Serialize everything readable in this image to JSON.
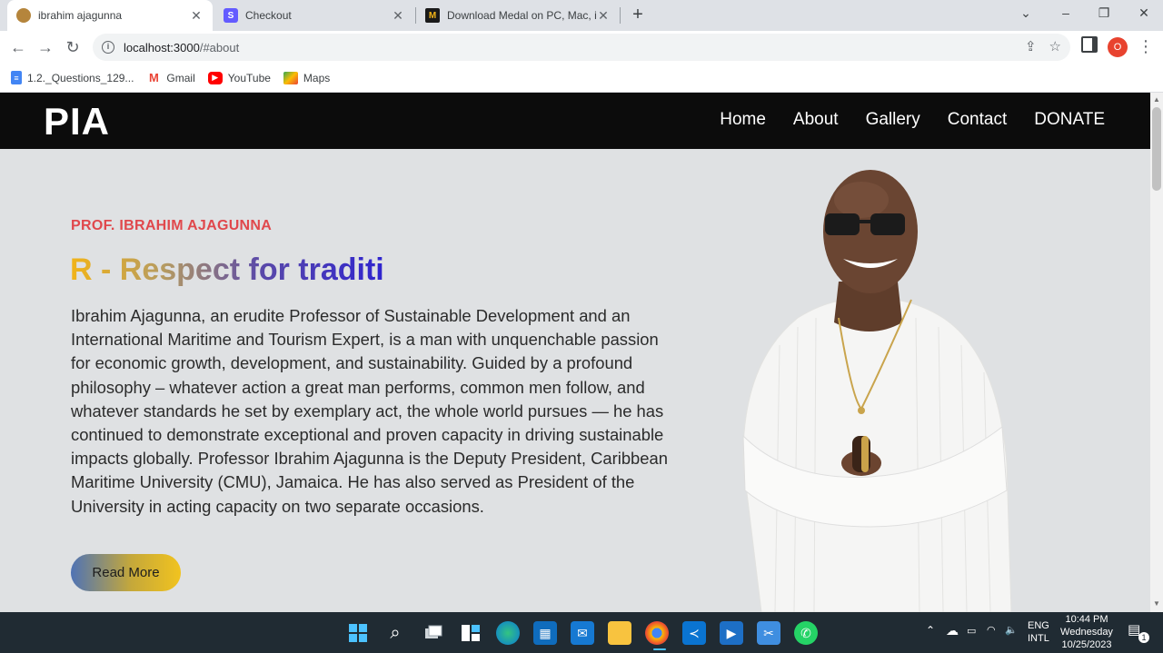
{
  "browser": {
    "tabs": [
      {
        "title": "ibrahim ajagunna",
        "active": true
      },
      {
        "title": "Checkout",
        "active": false
      },
      {
        "title": "Download Medal on PC, Mac, iO",
        "active": false
      }
    ],
    "url_host": "localhost:3000",
    "url_path": "/#about",
    "profile_initial": "O",
    "bookmarks": [
      {
        "label": "1.2._Questions_129...",
        "icon": "docs-icon"
      },
      {
        "label": "Gmail",
        "icon": "gmail-icon"
      },
      {
        "label": "YouTube",
        "icon": "youtube-icon"
      },
      {
        "label": "Maps",
        "icon": "maps-icon"
      }
    ]
  },
  "site": {
    "logo": "PIA",
    "menu": [
      "Home",
      "About",
      "Gallery",
      "Contact",
      "DONATE"
    ],
    "eyebrow": "PROF. IBRAHIM AJAGUNNA",
    "headline": "R - Respect for traditi",
    "body": "Ibrahim Ajagunna, an erudite Professor of Sustainable Development and an International Maritime and Tourism Expert, is a man with unquenchable passion for economic growth, development, and sustainability. Guided by a profound philosophy – whatever action a great man performs, common men follow, and whatever standards he set by exemplary act, the whole world pursues — he has continued to demonstrate exceptional and proven capacity in driving sustainable impacts globally. Professor Ibrahim Ajagunna is the Deputy President, Caribbean Maritime University (CMU), Jamaica. He has also served as President of the University in acting capacity on two separate occasions.",
    "cta": "Read More"
  },
  "taskbar": {
    "apps": [
      "windows-start",
      "search",
      "task-view",
      "widgets",
      "edge",
      "store",
      "mail",
      "file-explorer",
      "chrome",
      "vscode",
      "media-player",
      "snipping-tool",
      "whatsapp"
    ],
    "lang_top": "ENG",
    "lang_bottom": "INTL",
    "time": "10:44 PM",
    "day": "Wednesday",
    "date": "10/25/2023",
    "notification_count": "1"
  },
  "colors": {
    "eyebrow": "#e0484c",
    "nav_bg": "#0c0c0c",
    "page_bg": "#dfe1e3"
  }
}
